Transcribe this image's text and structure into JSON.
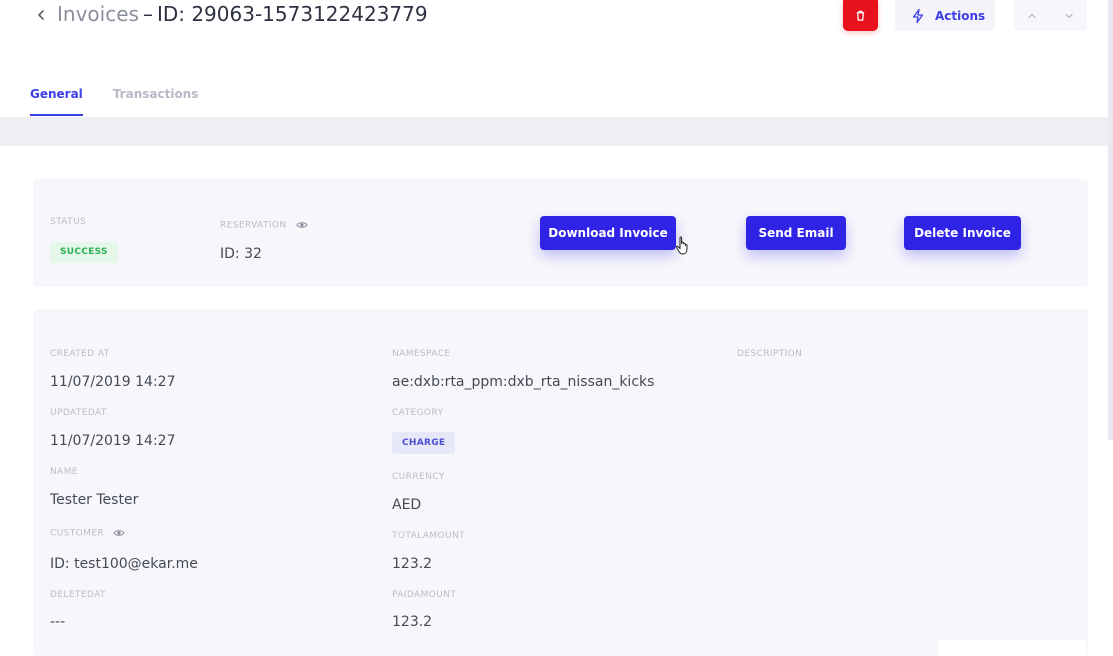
{
  "header": {
    "breadcrumb": "Invoices",
    "separator": "–",
    "record_id": "ID: 29063-1573122423779",
    "back_icon": "chevron-left-icon",
    "trash_icon": "trash-icon",
    "actions_label": "Actions",
    "actions_icon": "lightning-icon",
    "prev_icon": "chevron-up-icon",
    "next_icon": "chevron-down-icon"
  },
  "tabs": [
    {
      "label": "General",
      "active": true
    },
    {
      "label": "Transactions",
      "active": false
    }
  ],
  "summary": {
    "status_label": "STATUS",
    "status_value": "SUCCESS",
    "reservation_label": "RESERVATION",
    "reservation_value": "ID: 32",
    "buttons": {
      "download": "Download Invoice",
      "send_email": "Send Email",
      "delete": "Delete Invoice"
    }
  },
  "details": {
    "created_at_label": "CREATED AT",
    "created_at": "11/07/2019 14:27",
    "updated_at_label": "UPDATEDAT",
    "updated_at": "11/07/2019 14:27",
    "name_label": "NAME",
    "name": "Tester Tester",
    "customer_label": "CUSTOMER",
    "customer": "ID: test100@ekar.me",
    "deleted_at_label": "DELETEDAT",
    "deleted_at": "---",
    "namespace_label": "NAMESPACE",
    "namespace": "ae:dxb:rta_ppm:dxb_rta_nissan_kicks",
    "category_label": "CATEGORY",
    "category": "CHARGE",
    "currency_label": "CURRENCY",
    "currency": "AED",
    "total_amount_label": "TOTALAMOUNT",
    "total_amount": "123.2",
    "paid_amount_label": "PAIDAMOUNT",
    "paid_amount": "123.2",
    "description_label": "DESCRIPTION"
  },
  "colors": {
    "primary": "#2f23e6",
    "danger": "#e8121d",
    "success": "#2db456",
    "accent": "#3b3ee6"
  }
}
